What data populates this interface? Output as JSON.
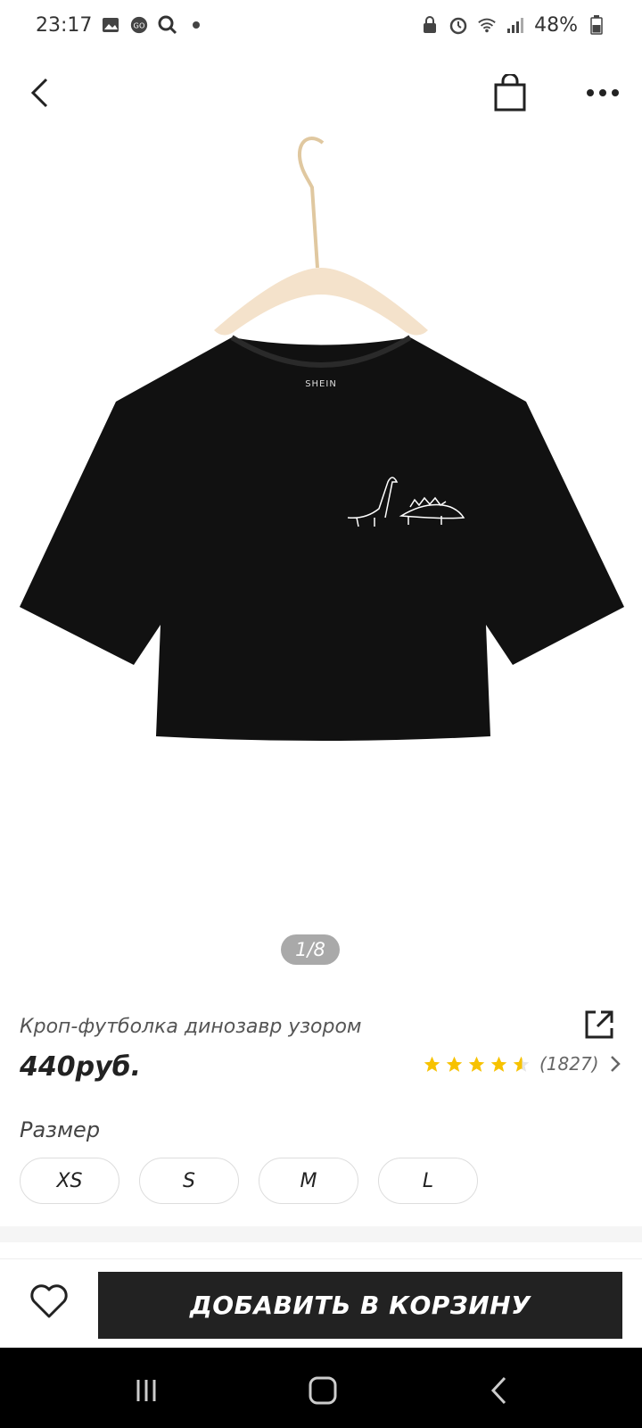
{
  "status_bar": {
    "time": "23:17",
    "battery": "48%"
  },
  "nav": {
    "back_icon": "back-arrow-icon",
    "bag_icon": "shopping-bag-icon",
    "more_icon": "more-dots-icon"
  },
  "product": {
    "image_pager": "1/8",
    "brand_tag": "SHEIN",
    "title": "Кроп-футболка динозавр узором",
    "price": "440руб.",
    "rating_stars": 4.5,
    "rating_count": "(1827)"
  },
  "sizes": {
    "label": "Размер",
    "options": [
      "XS",
      "S",
      "M",
      "L"
    ]
  },
  "actions": {
    "add_to_cart": "ДОБАВИТЬ В КОРЗИНУ"
  },
  "colors": {
    "accent_star": "#f7c200",
    "button_dark": "#222222"
  }
}
